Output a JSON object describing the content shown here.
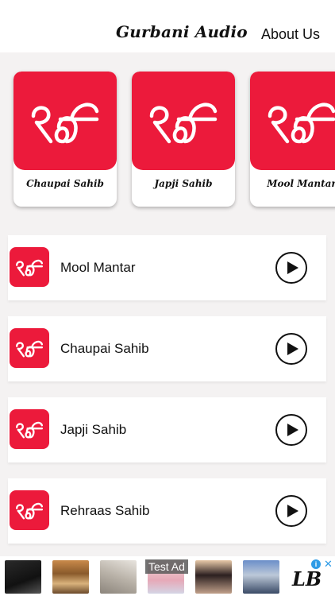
{
  "header": {
    "title": "Gurbani Audio",
    "about_label": "About Us"
  },
  "featured": [
    {
      "label": "Chaupai Sahib",
      "icon": "ik-onkar-icon"
    },
    {
      "label": "Japji Sahib",
      "icon": "ik-onkar-icon"
    },
    {
      "label": "Mool Mantar",
      "icon": "ik-onkar-icon"
    }
  ],
  "tracks": [
    {
      "title": "Mool Mantar",
      "icon": "ik-onkar-icon",
      "action": "play-icon"
    },
    {
      "title": "Chaupai Sahib",
      "icon": "ik-onkar-icon",
      "action": "play-icon"
    },
    {
      "title": "Japji Sahib",
      "icon": "ik-onkar-icon",
      "action": "play-icon"
    },
    {
      "title": "Rehraas Sahib",
      "icon": "ik-onkar-icon",
      "action": "play-icon"
    }
  ],
  "ad": {
    "label": "Test Ad",
    "info_glyph": "i",
    "close_glyph": "✕",
    "logo_text": "LB"
  },
  "colors": {
    "accent": "#ec1a3b",
    "background": "#f4f2f2",
    "card": "#ffffff",
    "text": "#111111"
  }
}
